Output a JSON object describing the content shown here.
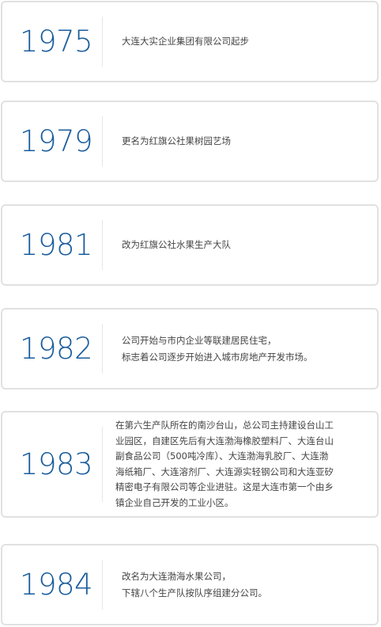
{
  "timeline": [
    {
      "year": "1975",
      "lines": [
        "大连大实企业集团有限公司起步"
      ]
    },
    {
      "year": "1979",
      "lines": [
        "更名为红旗公社果树园艺场"
      ]
    },
    {
      "year": "1981",
      "lines": [
        "改为红旗公社水果生产大队"
      ]
    },
    {
      "year": "1982",
      "lines": [
        "公司开始与市内企业等联建居民住宅，",
        "标志着公司逐步开始进入城市房地产开发市场。"
      ]
    },
    {
      "year": "1983",
      "lines": [
        "在第六生产队所在的南沙台山，总公司主持建设台山工",
        "业园区，自建区先后有大连渤海橡胶塑料厂、大连台山",
        "副食品公司（500吨冷库）、大连渤海乳胶厂、大连渤",
        "海纸箱厂、大连溶剂厂、大连源实轻钢公司和大连亚矽",
        "精密电子有限公司等企业进驻。这是大连市第一个由乡",
        "镇企业自己开发的工业小区。"
      ]
    },
    {
      "year": "1984",
      "lines": [
        "改名为大连渤海水果公司，",
        "下辖八个生产队按队序组建分公司。"
      ]
    }
  ]
}
